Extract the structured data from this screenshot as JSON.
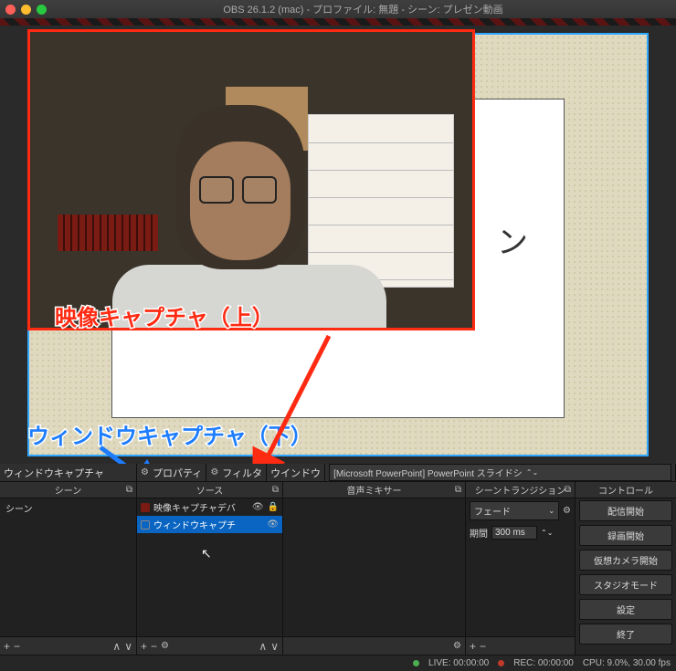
{
  "titlebar": {
    "title": "OBS 26.1.2 (mac) - プロファイル: 無題 - シーン: プレゼン動画"
  },
  "annotations": {
    "capture_top": "映像キャプチャ（上）",
    "capture_bottom": "ウィンドウキャプチャ（下）"
  },
  "topbar": {
    "window_capture_label": "ウィンドウキャプチャ",
    "property": "プロパティ",
    "filter": "フィルタ",
    "window_label": "ウインドウ",
    "window_value": "[Microsoft PowerPoint] PowerPoint スライドシ"
  },
  "panels": {
    "scenes_title": "シーン",
    "sources_title": "ソース",
    "mixer_title": "音声ミキサー",
    "transition_title": "シーントランジション",
    "controls_title": "コントロール"
  },
  "scenes": {
    "items": [
      "シーン"
    ]
  },
  "sources": {
    "items": [
      {
        "label": "映像キャプチャデバ",
        "eye": true,
        "lock": true,
        "selected": false,
        "icon": "cam"
      },
      {
        "label": "ウィンドウキャプチ",
        "eye": true,
        "lock": false,
        "selected": true,
        "icon": "win"
      }
    ]
  },
  "transition": {
    "type": "フェード",
    "duration_label": "期間",
    "duration_value": "300 ms"
  },
  "controls": {
    "buttons": [
      "配信開始",
      "録画開始",
      "仮想カメラ開始",
      "スタジオモード",
      "設定",
      "終了"
    ]
  },
  "tools": {
    "plus": "+",
    "minus": "−",
    "up": "∧",
    "down": "∨"
  },
  "status": {
    "live": "LIVE: 00:00:00",
    "rec": "REC: 00:00:00",
    "cpu": "CPU: 9.0%, 30.00 fps"
  },
  "ppt_visible": "ン"
}
